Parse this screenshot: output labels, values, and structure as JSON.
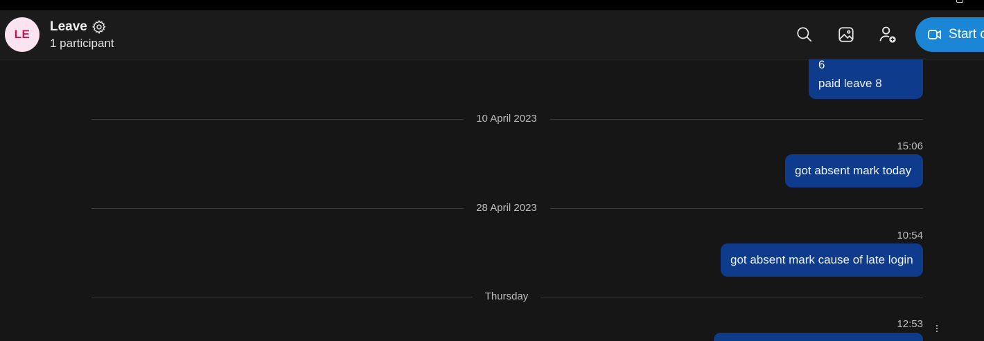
{
  "header": {
    "avatar_initials": "LE",
    "title": "Leave",
    "subtitle": "1 participant",
    "start_call_label": "Start c",
    "icons": [
      "gear-icon",
      "search-icon",
      "image-icon",
      "add-person-icon",
      "video-call-icon"
    ],
    "accent_color": "#1c86d6"
  },
  "messages": {
    "partial_line_1": "6",
    "partial_line_2": "paid leave 8",
    "sep_1": "10 April 2023",
    "time_1": "15:06",
    "msg_1": "got absent mark today",
    "sep_2": "28 April 2023",
    "time_2": "10:54",
    "msg_2": "got absent mark cause of late login",
    "sep_3": "Thursday",
    "time_3": "12:53",
    "bubble_color": "#0f3b8c"
  }
}
